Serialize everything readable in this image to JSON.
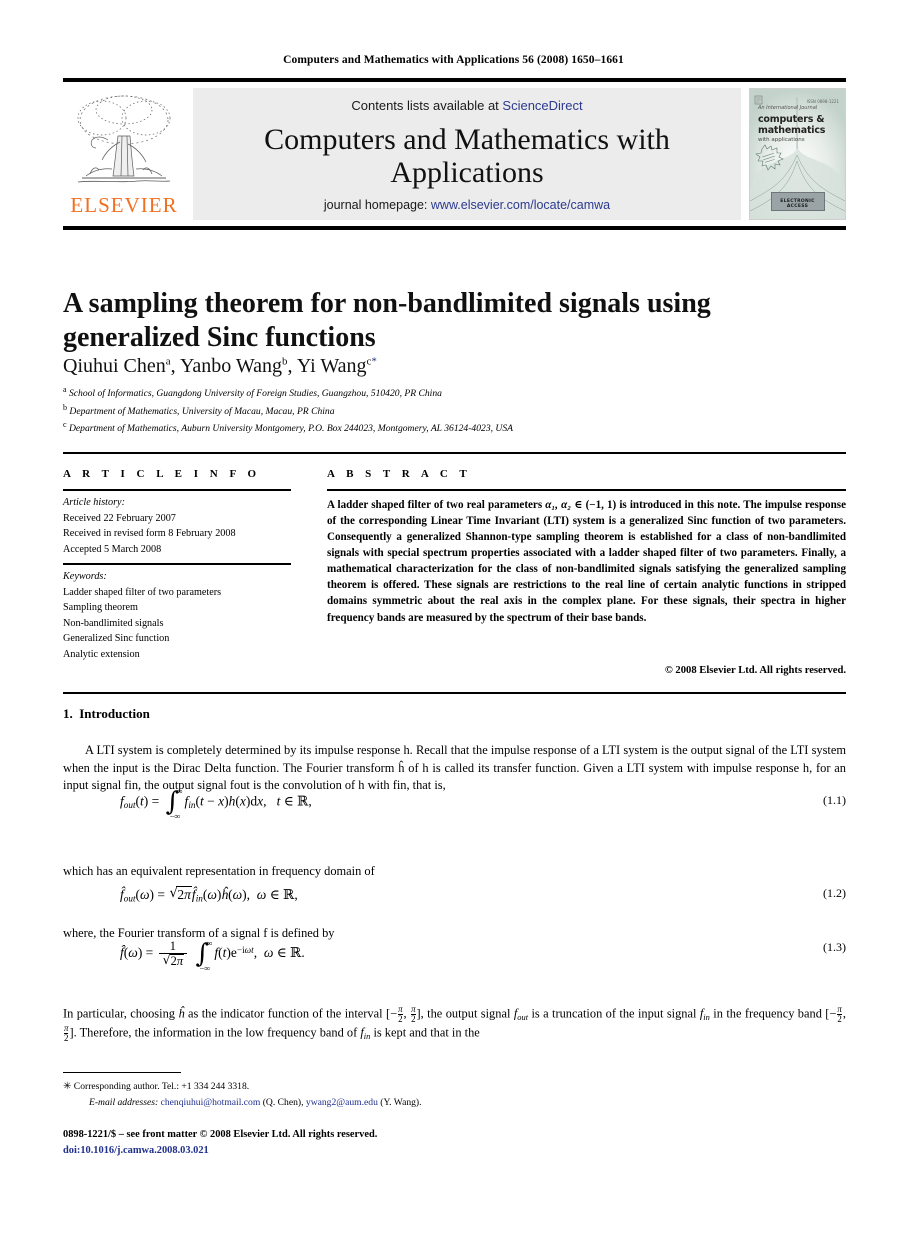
{
  "running_head": "Computers and Mathematics with Applications 56 (2008) 1650–1661",
  "masthead": {
    "contents_prefix": "Contents lists available at ",
    "sciencedirect": "ScienceDirect",
    "journal_title": "Computers and Mathematics with Applications",
    "homepage_label": "journal homepage: ",
    "homepage_url": "www.elsevier.com/locate/camwa",
    "publisher": "ELSEVIER",
    "link_color": "#2b3a8f",
    "elsevier_orange": "#F27021",
    "banner_bg": "#ececec"
  },
  "cover": {
    "kicker": "An International Journal",
    "line1": "computers &",
    "line2": "mathematics",
    "line3": "with applications",
    "issn": "ISSN 0898-1221",
    "badge": "ELECTRONIC ACCESS"
  },
  "article": {
    "title": "A sampling theorem for non-bandlimited signals using generalized Sinc functions",
    "authors": [
      {
        "name": "Qiuhui Chen",
        "marker": "a"
      },
      {
        "name": "Yanbo Wang",
        "marker": "b"
      },
      {
        "name": "Yi Wang",
        "marker": "c",
        "corresponding": "*"
      }
    ],
    "affiliations": [
      {
        "marker": "a",
        "text": "School of Informatics, Guangdong University of Foreign Studies, Guangzhou, 510420, PR China"
      },
      {
        "marker": "b",
        "text": "Department of Mathematics, University of Macau, Macau, PR China"
      },
      {
        "marker": "c",
        "text": "Department of Mathematics, Auburn University Montgomery, P.O. Box 244023, Montgomery, AL 36124-4023, USA"
      }
    ]
  },
  "info": {
    "header": "A R T I C L E  I N F O",
    "history_label": "Article history:",
    "history": [
      "Received 22 February 2007",
      "Received in revised form 8 February 2008",
      "Accepted 5 March 2008"
    ],
    "keywords_label": "Keywords:",
    "keywords": [
      "Ladder shaped filter of two parameters",
      "Sampling theorem",
      "Non-bandlimited signals",
      "Generalized Sinc function",
      "Analytic extension"
    ]
  },
  "abstract": {
    "header": "A B S T R A C T",
    "text_part1": "A ladder shaped filter of two real parameters ",
    "params": "α₁, α₂",
    "text_part2": " ∈ (−1, 1) is introduced in this note. The impulse response of the corresponding Linear Time Invariant (LTI) system is a generalized Sinc function of two parameters. Consequently a generalized Shannon-type sampling theorem is established for a class of non-bandlimited signals with special spectrum properties associated with a ladder shaped filter of two parameters. Finally, a mathematical characterization for the class of non-bandlimited signals satisfying the generalized sampling theorem is offered. These signals are restrictions to the real line of certain analytic functions in stripped domains symmetric about the real axis in the complex plane. For these signals, their spectra in higher frequency bands are measured by the spectrum of their base bands.",
    "copyright": "© 2008 Elsevier Ltd. All rights reserved."
  },
  "body": {
    "section_number": "1.",
    "section_title": "Introduction",
    "para1": "A LTI system is completely determined by its impulse response h. Recall that the impulse response of a LTI system is the output signal of the LTI system when the input is the Dirac Delta function. The Fourier transform ĥ of h is called its transfer function. Given a LTI system with impulse response h, for an input signal fin, the output signal fout is the convolution of h with fin, that is,",
    "para2": "which has an equivalent representation in frequency domain of",
    "para3": "where, the Fourier transform of a signal f is defined by",
    "para4": "In particular, choosing ĥ as the indicator function of the interval [−π/2, π/2], the output signal fout is a truncation of the input signal fin in the frequency band [−π/2, π/2]. Therefore, the information in the low frequency band of fin is kept and that in the",
    "eq1_number": "(1.1)",
    "eq2_number": "(1.2)",
    "eq3_number": "(1.3)"
  },
  "footnote": {
    "star": "✳",
    "corresponding": "Corresponding author. Tel.: +1 334 244 3318.",
    "email_label": "E-mail addresses:",
    "email1": "chenqiuhui@hotmail.com",
    "email1_who": "(Q. Chen),",
    "email2": "ywang2@aum.edu",
    "email2_who": "(Y. Wang).",
    "link_color": "#20308c"
  },
  "imprint": {
    "line1": "0898-1221/$ – see front matter © 2008 Elsevier Ltd. All rights reserved.",
    "doi": "doi:10.1016/j.camwa.2008.03.021"
  }
}
